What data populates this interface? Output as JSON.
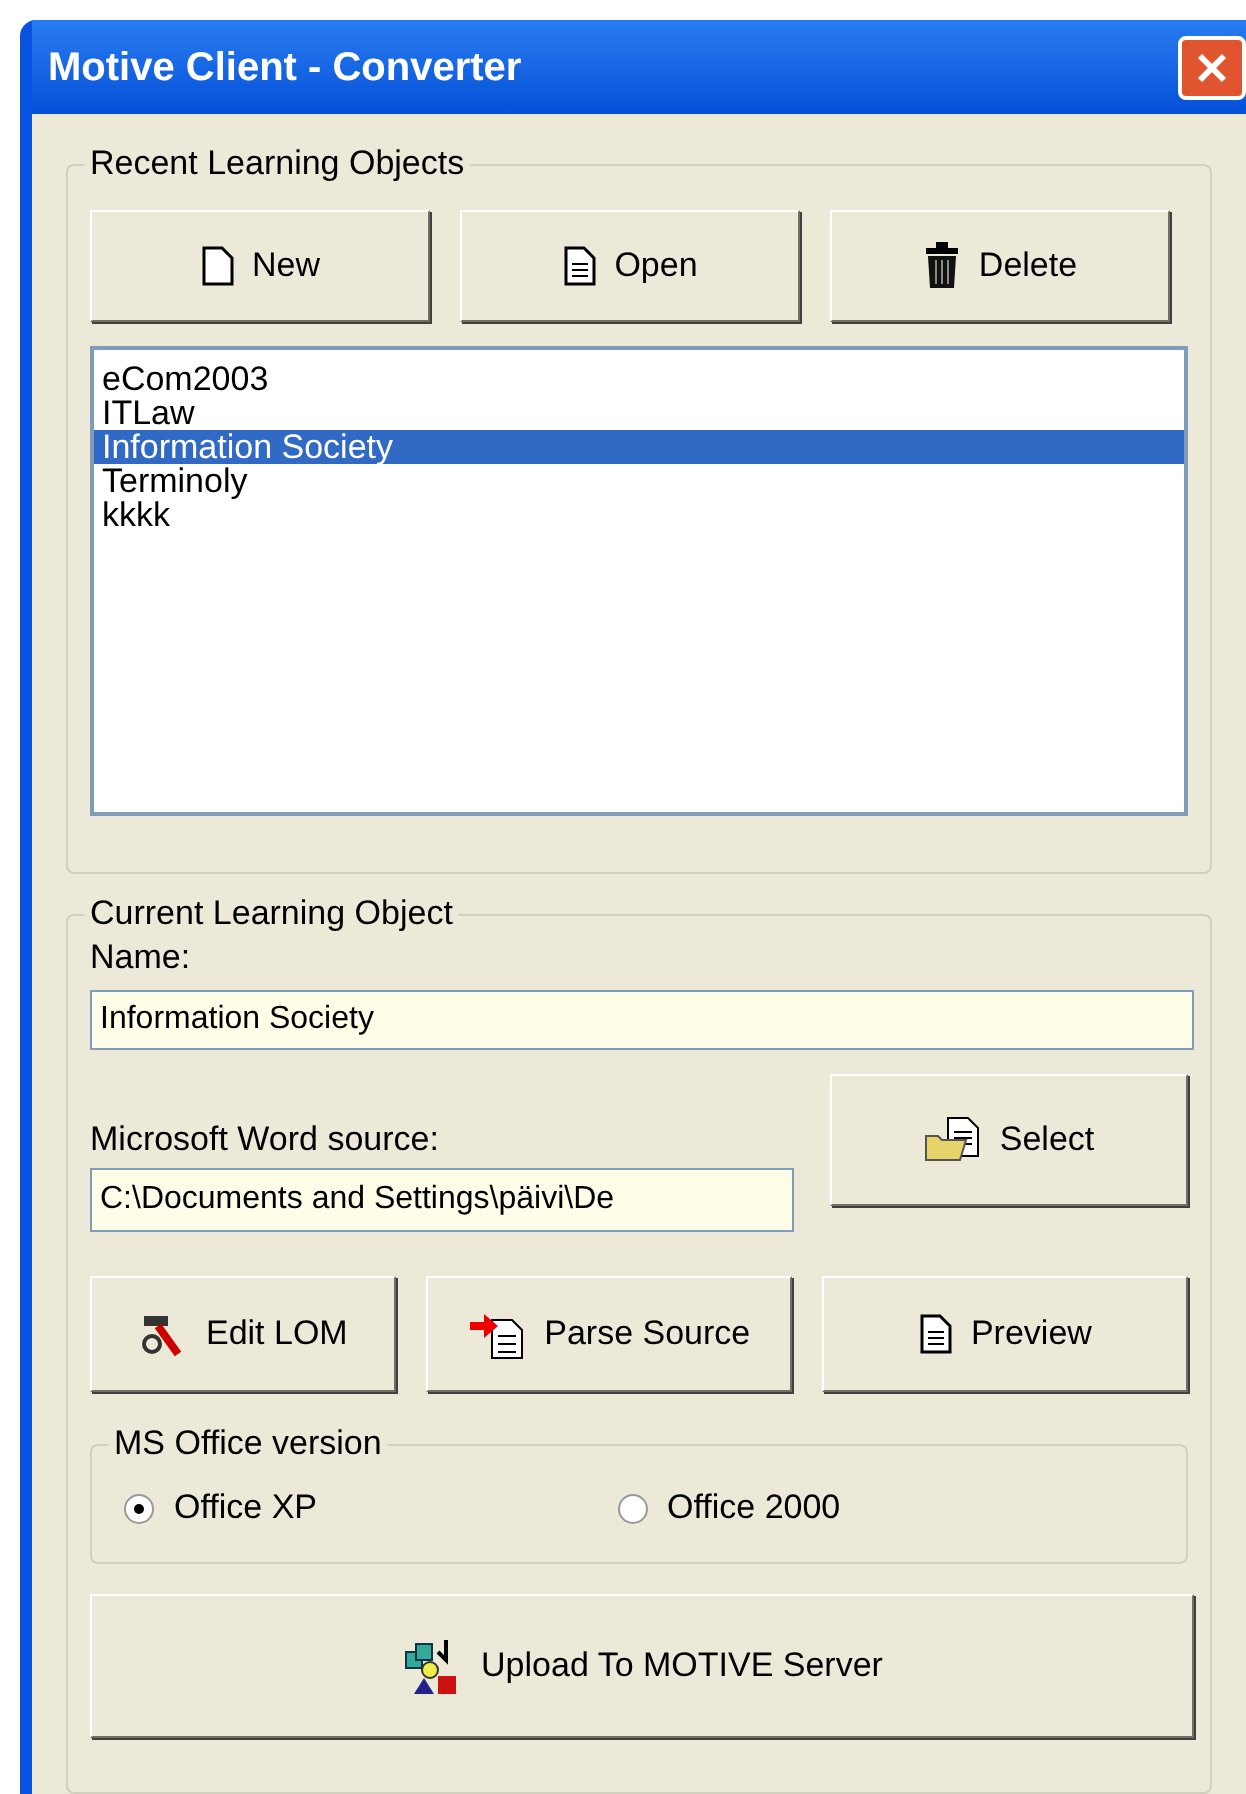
{
  "window": {
    "title": "Motive Client - Converter"
  },
  "recent": {
    "title": "Recent Learning Objects",
    "buttons": [
      {
        "label": "New"
      },
      {
        "label": "Open"
      },
      {
        "label": "Delete"
      }
    ],
    "items": [
      {
        "label": "eCom2003",
        "selected": false
      },
      {
        "label": "ITLaw",
        "selected": false
      },
      {
        "label": "Information Society",
        "selected": true
      },
      {
        "label": "Terminoly",
        "selected": false
      },
      {
        "label": "kkkk",
        "selected": false
      }
    ]
  },
  "current": {
    "title": "Current Learning Object",
    "name_label": "Name:",
    "name_value": "Information Society",
    "source_label": "Microsoft Word source:",
    "source_value": "C:\\Documents and Settings\\päivi\\De",
    "select_button": {
      "label": "Select"
    },
    "actions": [
      {
        "label": "Edit LOM"
      },
      {
        "label": "Parse Source"
      },
      {
        "label": "Preview"
      }
    ],
    "office": {
      "title": "MS Office version",
      "options": [
        {
          "label": "Office XP",
          "selected": true
        },
        {
          "label": "Office 2000",
          "selected": false
        }
      ]
    },
    "upload_button": {
      "label": "Upload To MOTIVE Server"
    }
  }
}
